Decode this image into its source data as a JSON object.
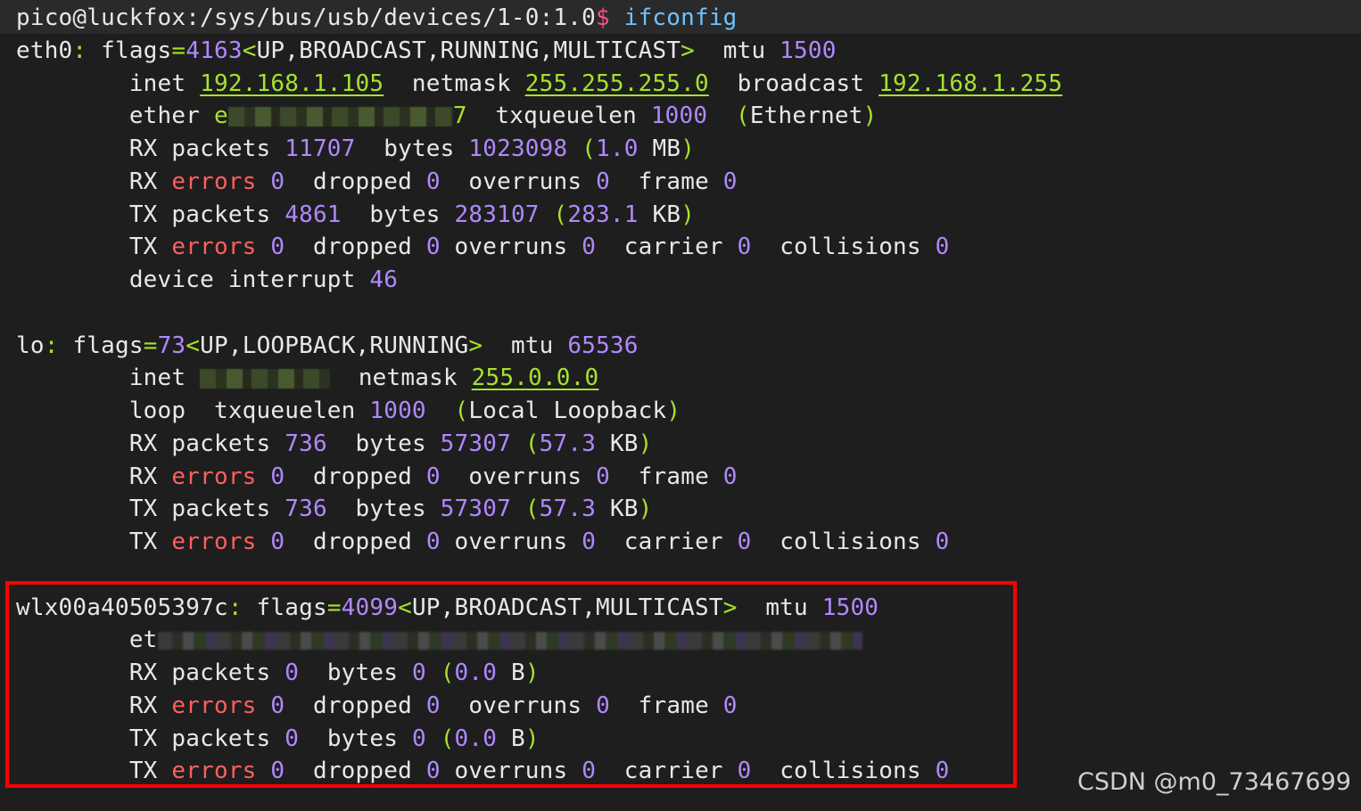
{
  "prompt": {
    "user_host": "pico@luckfox",
    "path": ":/sys/bus/usb/devices/1-0:1.0",
    "symbol": "$",
    "command": " ifconfig"
  },
  "eth0": {
    "name": "eth0",
    "flags_value": "4163",
    "flags_list": "UP,BROADCAST,RUNNING,MULTICAST",
    "mtu": "1500",
    "inet": "192.168.1.105",
    "netmask": "255.255.255.0",
    "broadcast": "192.168.1.255",
    "ether_start": "e",
    "ether_end": "7",
    "txqueuelen": "1000",
    "link_type": "Ethernet",
    "rx_packets": "11707",
    "rx_bytes": "1023098",
    "rx_bytes_h_num": "1.0",
    "rx_bytes_h_unit": "MB",
    "rx_errors": "0",
    "rx_dropped": "0",
    "rx_overruns": "0",
    "rx_frame": "0",
    "tx_packets": "4861",
    "tx_bytes": "283107",
    "tx_bytes_h_num": "283.1",
    "tx_bytes_h_unit": "KB",
    "tx_errors": "0",
    "tx_dropped": "0",
    "tx_overruns": "0",
    "tx_carrier": "0",
    "tx_collisions": "0",
    "device_interrupt": "46"
  },
  "lo": {
    "name": "lo",
    "flags_value": "73",
    "flags_list": "UP,LOOPBACK,RUNNING",
    "mtu": "65536",
    "netmask": "255.0.0.0",
    "txqueuelen": "1000",
    "link_type": "Local Loopback",
    "rx_packets": "736",
    "rx_bytes": "57307",
    "rx_bytes_h_num": "57.3",
    "rx_bytes_h_unit": "KB",
    "rx_errors": "0",
    "rx_dropped": "0",
    "rx_overruns": "0",
    "rx_frame": "0",
    "tx_packets": "736",
    "tx_bytes": "57307",
    "tx_bytes_h_num": "57.3",
    "tx_bytes_h_unit": "KB",
    "tx_errors": "0",
    "tx_dropped": "0",
    "tx_overruns": "0",
    "tx_carrier": "0",
    "tx_collisions": "0"
  },
  "wlan": {
    "name": "wlx00a40505397c",
    "flags_value": "4099",
    "flags_list": "UP,BROADCAST,MULTICAST",
    "mtu": "1500",
    "ether_start": "et",
    "rx_packets": "0",
    "rx_bytes": "0",
    "rx_bytes_h_num": "0.0",
    "rx_bytes_h_unit": "B",
    "rx_errors": "0",
    "rx_dropped": "0",
    "rx_overruns": "0",
    "rx_frame": "0",
    "tx_packets": "0",
    "tx_bytes": "0",
    "tx_bytes_h_num": "0.0",
    "tx_bytes_h_unit": "B",
    "tx_errors": "0",
    "tx_dropped": "0",
    "tx_overruns": "0",
    "tx_carrier": "0",
    "tx_collisions": "0"
  },
  "labels": {
    "flags": "flags",
    "mtu": "mtu",
    "inet": "inet",
    "netmask": "netmask",
    "broadcast": "broadcast",
    "ether": "ether",
    "loop": "loop",
    "txqueuelen": "txqueuelen",
    "rx": "RX",
    "tx": "TX",
    "packets": "packets",
    "bytes": "bytes",
    "errors": "errors",
    "dropped": "dropped",
    "overruns": "overruns",
    "frame": "frame",
    "carrier": "carrier",
    "collisions": "collisions",
    "device_interrupt": "device interrupt"
  },
  "watermark": "CSDN @m0_73467699",
  "colors": {
    "background": "#1e1e1e",
    "text": "#e8e8e8",
    "green": "#a6e22e",
    "purple": "#b088ff",
    "red": "#ff5f5f",
    "highlight_border": "#ff0000"
  }
}
